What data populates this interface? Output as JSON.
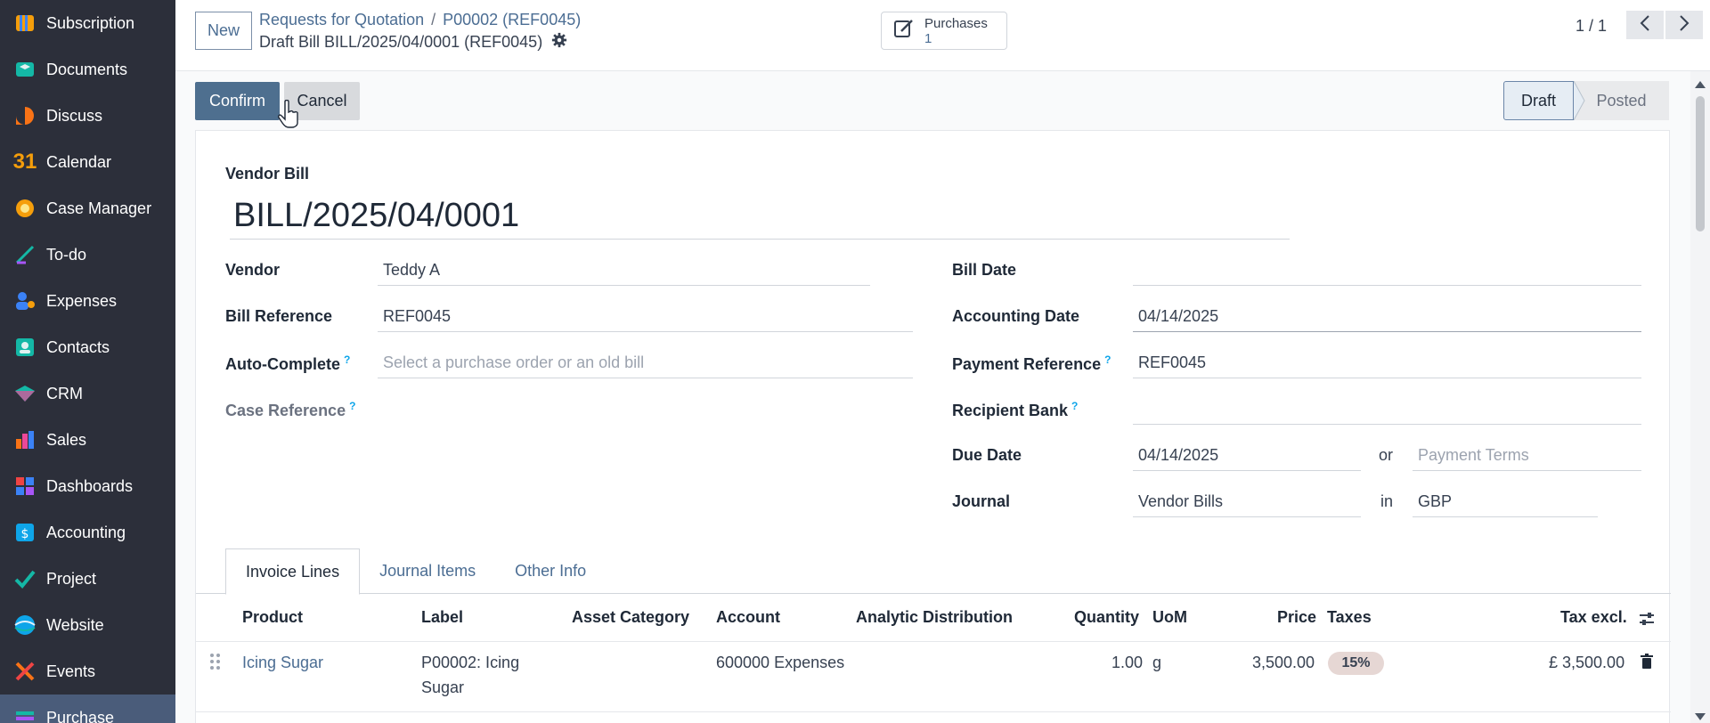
{
  "sidebar": {
    "items": [
      {
        "label": "Subscription",
        "icon": "subscription-icon"
      },
      {
        "label": "Documents",
        "icon": "documents-icon"
      },
      {
        "label": "Discuss",
        "icon": "discuss-icon"
      },
      {
        "label": "Calendar",
        "icon": "calendar-icon"
      },
      {
        "label": "Case Manager",
        "icon": "case-manager-icon"
      },
      {
        "label": "To-do",
        "icon": "todo-icon"
      },
      {
        "label": "Expenses",
        "icon": "expenses-icon"
      },
      {
        "label": "Contacts",
        "icon": "contacts-icon"
      },
      {
        "label": "CRM",
        "icon": "crm-icon"
      },
      {
        "label": "Sales",
        "icon": "sales-icon"
      },
      {
        "label": "Dashboards",
        "icon": "dashboards-icon"
      },
      {
        "label": "Accounting",
        "icon": "accounting-icon"
      },
      {
        "label": "Project",
        "icon": "project-icon"
      },
      {
        "label": "Website",
        "icon": "website-icon"
      },
      {
        "label": "Events",
        "icon": "events-icon"
      },
      {
        "label": "Purchase",
        "icon": "purchase-icon"
      }
    ],
    "calendar_glyph": "31"
  },
  "header": {
    "new_label": "New",
    "breadcrumb_1": "Requests for Quotation",
    "breadcrumb_sep": "/",
    "breadcrumb_2": "P00002 (REF0045)",
    "record_title": "Draft Bill BILL/2025/04/0001 (REF0045)",
    "smart_button_label": "Purchases",
    "smart_button_count": "1",
    "pager": "1 / 1"
  },
  "actions": {
    "confirm_label": "Confirm",
    "cancel_label": "Cancel"
  },
  "statusbar": {
    "draft": "Draft",
    "posted": "Posted"
  },
  "form": {
    "type_label": "Vendor Bill",
    "name": "BILL/2025/04/0001",
    "vendor_label": "Vendor",
    "vendor": "Teddy A",
    "bill_reference_label": "Bill Reference",
    "bill_reference": "REF0045",
    "auto_complete_label": "Auto-Complete",
    "auto_complete_placeholder": "Select a purchase order or an old bill",
    "case_reference_label": "Case Reference",
    "help_mark": "?",
    "bill_date_label": "Bill Date",
    "bill_date": "",
    "accounting_date_label": "Accounting Date",
    "accounting_date": "04/14/2025",
    "payment_reference_label": "Payment Reference",
    "payment_reference": "REF0045",
    "recipient_bank_label": "Recipient Bank",
    "recipient_bank": "",
    "due_date_label": "Due Date",
    "due_date": "04/14/2025",
    "or_word": "or",
    "payment_terms_placeholder": "Payment Terms",
    "journal_label": "Journal",
    "journal": "Vendor Bills",
    "in_word": "in",
    "currency": "GBP"
  },
  "tabs": [
    {
      "label": "Invoice Lines",
      "active": true
    },
    {
      "label": "Journal Items",
      "active": false
    },
    {
      "label": "Other Info",
      "active": false
    }
  ],
  "table": {
    "headers": {
      "product": "Product",
      "label": "Label",
      "asset_category": "Asset Category",
      "account": "Account",
      "analytic": "Analytic Distribution",
      "quantity": "Quantity",
      "uom": "UoM",
      "price": "Price",
      "taxes": "Taxes",
      "tax_excl": "Tax excl."
    },
    "rows": [
      {
        "product": "Icing Sugar",
        "label_line1": "P00002: Icing",
        "label_line2": "Sugar",
        "account": "600000 Expenses",
        "quantity": "1.00",
        "uom": "g",
        "price": "3,500.00",
        "tax": "15%",
        "subtotal": "£ 3,500.00"
      }
    ]
  },
  "colors": {
    "sidebar_bg": "#2c2f3a",
    "primary": "#4e6f8f",
    "link": "#4b6d93"
  }
}
